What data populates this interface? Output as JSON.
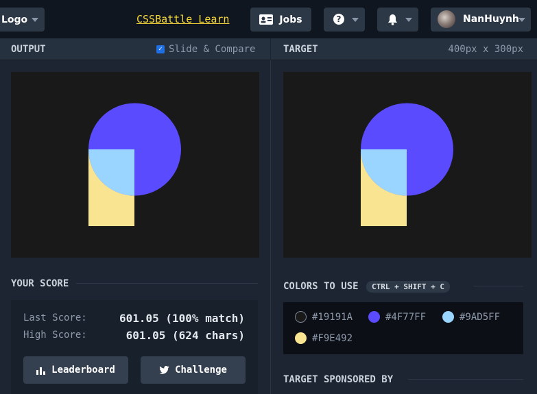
{
  "topbar": {
    "logo_label": "Logo",
    "learn_link": "CSSBattle Learn",
    "jobs_label": "Jobs",
    "help_glyph": "?",
    "user_name": "NanHuynh"
  },
  "output_panel": {
    "title": "OUTPUT",
    "slide_compare_label": "Slide & Compare",
    "slide_compare_checked": true
  },
  "target_panel": {
    "title": "TARGET",
    "dimensions": "400px x 300px"
  },
  "score": {
    "title": "YOUR SCORE",
    "last_label": "Last Score:",
    "last_value": "601.05 (100% match)",
    "high_label": "High Score:",
    "high_value": "601.05 (624 chars)",
    "leaderboard_label": "Leaderboard",
    "challenge_label": "Challenge"
  },
  "colors": {
    "title": "COLORS TO USE",
    "shortcut": "CTRL + SHIFT + C",
    "swatches": [
      {
        "hex": "#19191A"
      },
      {
        "hex": "#4F77FF"
      },
      {
        "hex": "#9AD5FF"
      },
      {
        "hex": "#F9E492"
      }
    ]
  },
  "sponsor": {
    "title": "TARGET SPONSORED BY"
  },
  "render_colors": {
    "background": "#19191A",
    "circle": "#5B4BFF",
    "light_blue": "#9AD5FF",
    "yellow": "#F9E492"
  },
  "icons": [
    "caret-down-icon",
    "id-card-icon",
    "help-icon",
    "bell-icon",
    "avatar",
    "checkbox-icon",
    "bar-chart-icon",
    "twitter-icon"
  ]
}
